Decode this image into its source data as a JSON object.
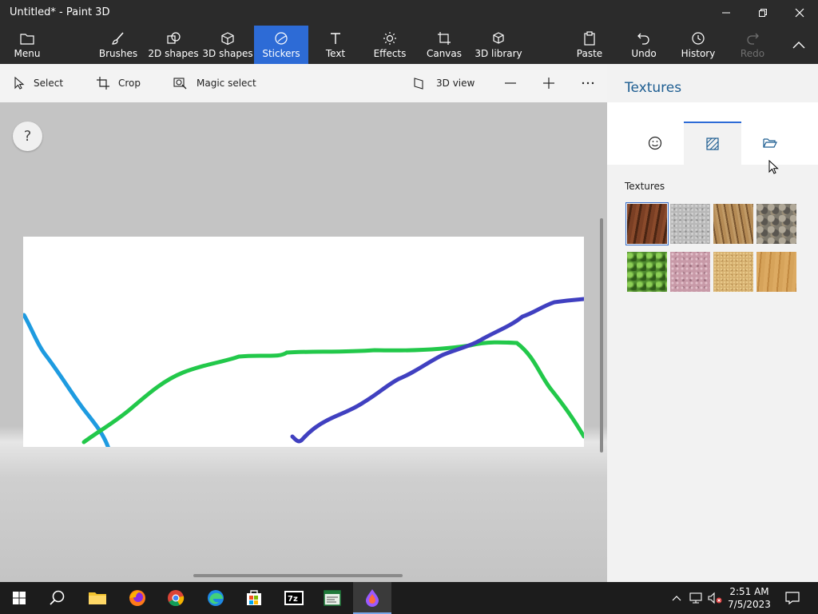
{
  "window": {
    "title": "Untitled* - Paint 3D"
  },
  "ribbon": {
    "menu": "Menu",
    "brushes": "Brushes",
    "shapes2d": "2D shapes",
    "shapes3d": "3D shapes",
    "stickers": "Stickers",
    "text": "Text",
    "effects": "Effects",
    "canvas": "Canvas",
    "library3d": "3D library",
    "paste": "Paste",
    "undo": "Undo",
    "history": "History",
    "redo": "Redo"
  },
  "toolbar": {
    "select": "Select",
    "crop": "Crop",
    "magic_select": "Magic select",
    "view3d": "3D view"
  },
  "help": "?",
  "panel": {
    "title": "Textures",
    "section": "Textures",
    "textures": [
      {
        "icon": "bark-texture",
        "color": "#6e3b22"
      },
      {
        "icon": "granite-texture",
        "color": "#b9b9b9"
      },
      {
        "icon": "hair-texture",
        "color": "#a07a4a"
      },
      {
        "icon": "pebbles-texture",
        "color": "#7d786c"
      },
      {
        "icon": "leaves-texture",
        "color": "#4f8a2e"
      },
      {
        "icon": "pink-marble-texture",
        "color": "#c89aa8"
      },
      {
        "icon": "sand-texture",
        "color": "#d6b070"
      },
      {
        "icon": "wood-texture",
        "color": "#d19c52"
      }
    ]
  },
  "taskbar": {
    "time": "2:51 AM",
    "date": "7/5/2023"
  },
  "colors": {
    "accent": "#2d6bd6",
    "stroke_cyan": "#1e9be0",
    "stroke_green": "#22c84a",
    "stroke_blue": "#4040c0"
  }
}
